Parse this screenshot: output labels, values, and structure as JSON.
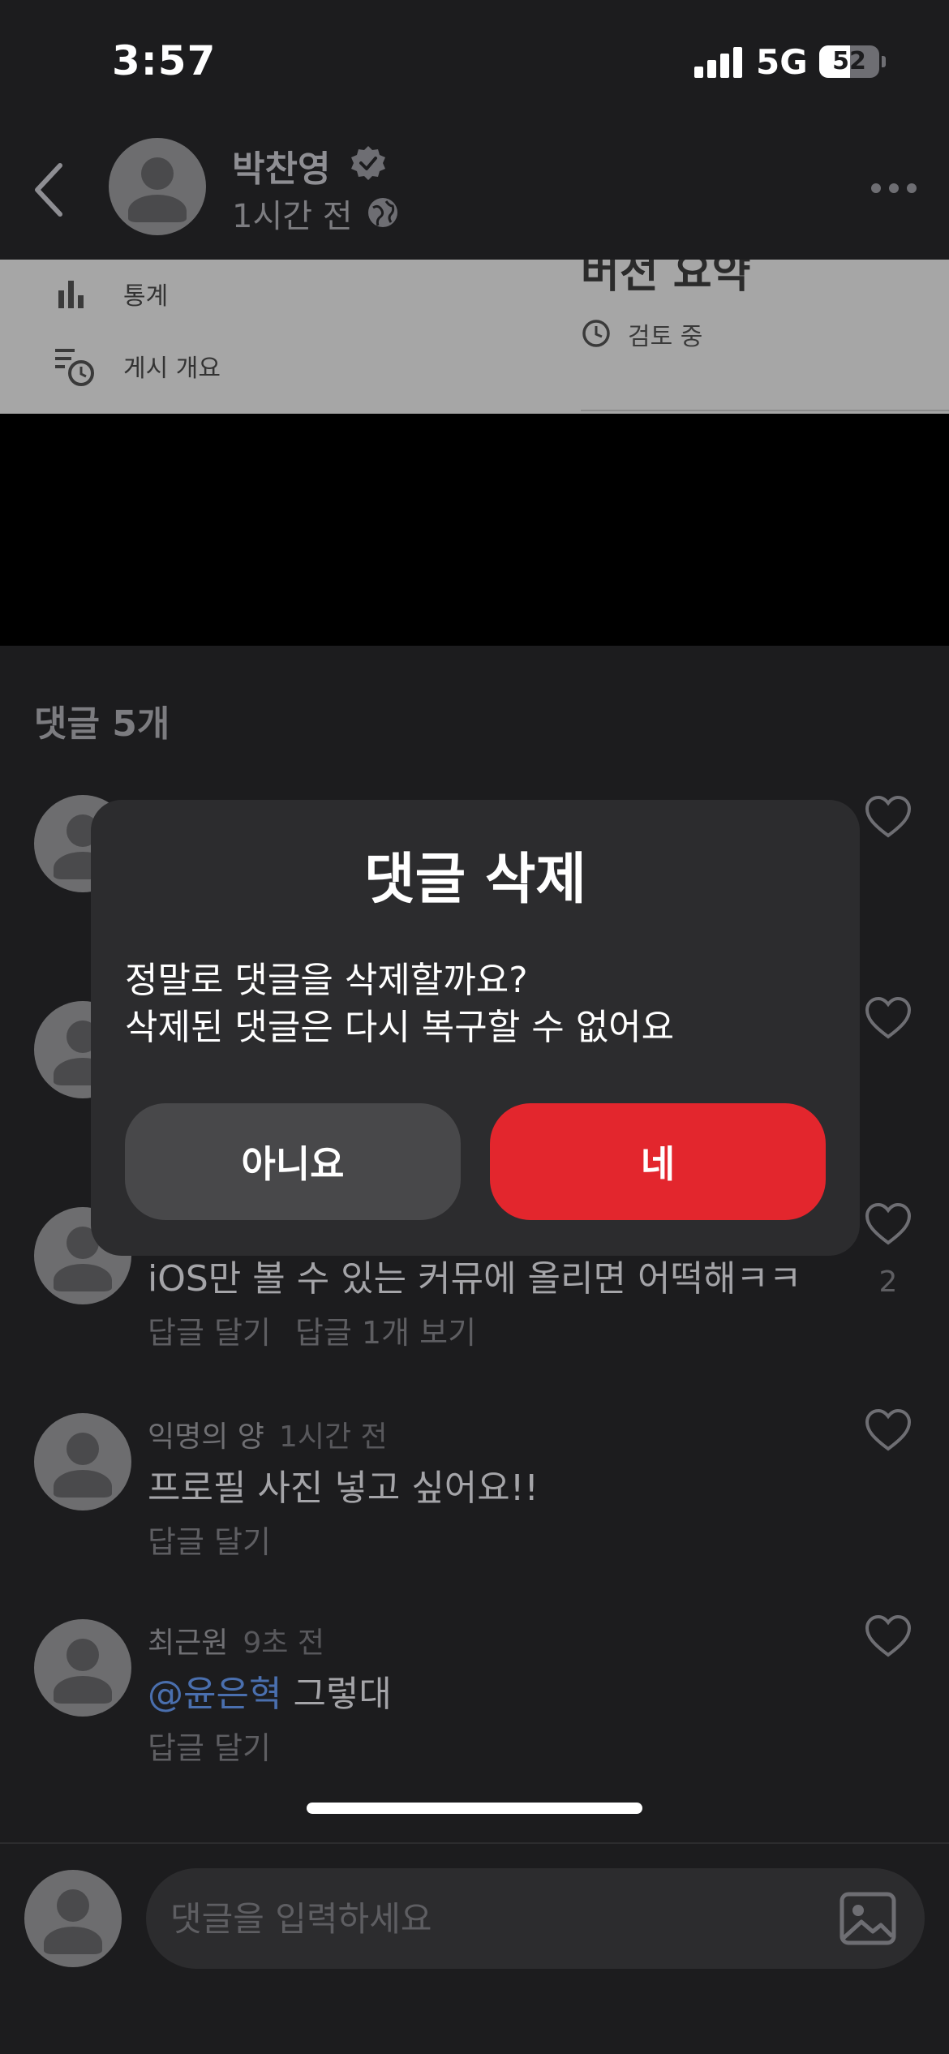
{
  "status_bar": {
    "time": "3:57",
    "network": "5G",
    "battery": 52,
    "battery_label": "52"
  },
  "post": {
    "author": "박찬영",
    "time": "1시간 전",
    "icons": {
      "back": "chevron-left-icon",
      "verified": "verified-badge-icon",
      "visibility": "globe-icon",
      "more": "more-horizontal-icon"
    }
  },
  "media": {
    "menu": [
      {
        "label": "통계",
        "icon": "bar-chart-icon"
      },
      {
        "label": "게시 개요",
        "icon": "list-clock-icon"
      }
    ],
    "title": "버전 요약",
    "status": "검토 중"
  },
  "comments": {
    "header": "댓글 5개",
    "items": [
      {
        "name": "",
        "time": "",
        "text": "",
        "actions": [],
        "likes": ""
      },
      {
        "name": "",
        "time": "",
        "text": "",
        "actions": [],
        "likes": ""
      },
      {
        "name": "",
        "time": "",
        "text": "iOS만 볼 수 있는 커뮤에 올리면 어떡해ㅋㅋ",
        "actions": [
          "답글 달기",
          "답글 1개 보기"
        ],
        "likes": "2"
      },
      {
        "name": "익명의 양",
        "time": "1시간 전",
        "text": "프로필 사진 넣고 싶어요!!",
        "actions": [
          "답글 달기"
        ],
        "likes": ""
      },
      {
        "name": "최근원",
        "time": "9초 전",
        "mention": "@윤은혁",
        "text": "그렇대",
        "actions": [
          "답글 달기"
        ],
        "likes": ""
      }
    ]
  },
  "comment_input": {
    "placeholder": "댓글을 입력하세요",
    "icon": "image-icon"
  },
  "dialog": {
    "title": "댓글 삭제",
    "message_line1": "정말로 댓글을 삭제할까요?",
    "message_line2": "삭제된 댓글은 다시 복구할 수 없어요",
    "cancel_label": "아니요",
    "confirm_label": "네",
    "confirm_color": "#e3262d",
    "cancel_color": "#48484a"
  }
}
